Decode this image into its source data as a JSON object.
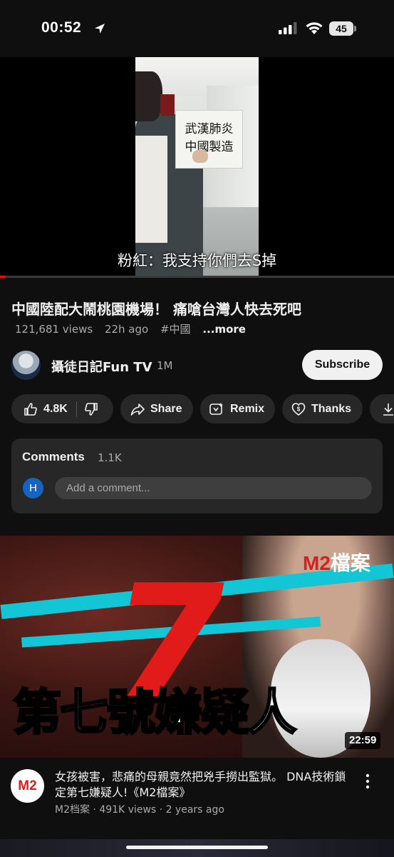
{
  "status": {
    "time": "00:52",
    "battery": "45"
  },
  "player": {
    "sign_lines": [
      "武漢肺炎",
      "中國製造"
    ],
    "subtitle": "粉紅：我支持你們去S掉",
    "progress_fraction": 0.015
  },
  "video": {
    "title": "中國陸配大鬧桃園機場！ 痛嗆台灣人快去死吧",
    "views": "121,681 views",
    "age": "22h ago",
    "hashtag": "#中國",
    "more": "...more"
  },
  "channel": {
    "name": "攝徒日記Fun TV",
    "subscribers": "1M",
    "subscribe_label": "Subscribe"
  },
  "actions": {
    "like_count": "4.8K",
    "share_label": "Share",
    "remix_label": "Remix",
    "thanks_label": "Thanks"
  },
  "comments": {
    "title": "Comments",
    "count": "1.1K",
    "user_initial": "H",
    "placeholder": "Add a comment..."
  },
  "next_video": {
    "logo_m2": "M2",
    "logo_text": "檔案",
    "thumb_title_red": "第七號",
    "thumb_title_white": "嫌疑人",
    "duration": "22:59",
    "channel_avatar_text": "M2",
    "title": "女孩被害，悲痛的母親竟然把兇手撈出監獄。 DNA技術鎖定第七嫌疑人!《M2檔案》",
    "meta": "M2档案 · 491K views · 2 years ago"
  },
  "colors": {
    "background": "#0f0f0f",
    "chip": "#272727",
    "progress": "#ff0000",
    "comment_avatar": "#1565c0"
  }
}
